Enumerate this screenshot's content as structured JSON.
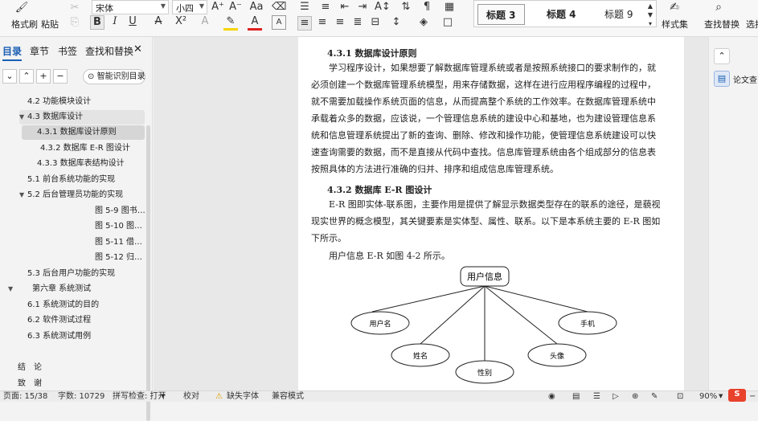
{
  "ribbon": {
    "format_painter": "格式刷",
    "paste": "粘贴",
    "font_name": "宋体",
    "font_size": "小四",
    "styles": [
      "标题 3",
      "标题 4",
      "标题 9"
    ],
    "style_set": "样式集",
    "find_replace": "查找替换",
    "select": "选择"
  },
  "nav": {
    "tabs": [
      "目录",
      "章节",
      "书签",
      "查找和替换"
    ],
    "smart_toc": "智能识别目录",
    "items": [
      "4.2 功能模块设计",
      "4.3 数据库设计",
      "4.3.1 数据库设计原则",
      "4.3.2 数据库 E-R 图设计",
      "4.3.3 数据库表结构设计",
      "5.1 前台系统功能的实现",
      "5.2 后台管理员功能的实现",
      "图 5-9 图书…",
      "图 5-10 图…",
      "图 5-11 借…",
      "图 5-12 归…",
      "5.3 后台用户功能的实现",
      "第六章 系统测试",
      "6.1 系统测试的目的",
      "6.2 软件测试过程",
      "6.3 系统测试用例",
      "结　论",
      "致　谢"
    ]
  },
  "doc": {
    "h431": "4.3.1 数据库设计原则",
    "p1": "学习程序设计，如果想要了解数据库管理系统或者是按照系统接口的要求制作的，就必须创建一个数据库管理系统模型，用来存储数据，这样在进行应用程序编程的过程中，就不需要加载操作系统页面的信息，从而提高整个系统的工作效率。在数据库管理系统中承载着众多的数据，应该说，一个管理信息系统的建设中心和基地，也为建设管理信息系统和信息管理系统提出了新的查询、删除、修改和操作功能，使管理信息系统建设可以快速查询需要的数据，而不是直接从代码中查找。信息库管理系统由各个组成部分的信息表按照具体的方法进行准确的归并、排序和组成信息库管理系统。",
    "h432": "4.3.2 数据库 E-R 图设计",
    "p2": "E-R 图即实体-联系图，主要作用是提供了解显示数据类型存在的联系的途径，是藐视现实世界的概念模型，其关键要素是实体型、属性、联系。以下是本系统主要的 E-R 图如下所示。",
    "p3": "用户信息 E-R 如图 4-2 所示。",
    "er": {
      "entity": "用户信息",
      "attributes": [
        "用户名",
        "姓名",
        "性别",
        "头像",
        "手机"
      ]
    }
  },
  "rail": {
    "thesis_check": "论文查"
  },
  "status": {
    "page": "页面: 15/38",
    "words": "字数: 10729",
    "spell": "拼写检查: 打开",
    "proof": "校对",
    "missing_font": "缺失字体",
    "compat": "兼容模式",
    "zoom": "90%"
  },
  "colors": {
    "accent": "#1a5fb4",
    "selected_toc": "#d6d6d6"
  }
}
